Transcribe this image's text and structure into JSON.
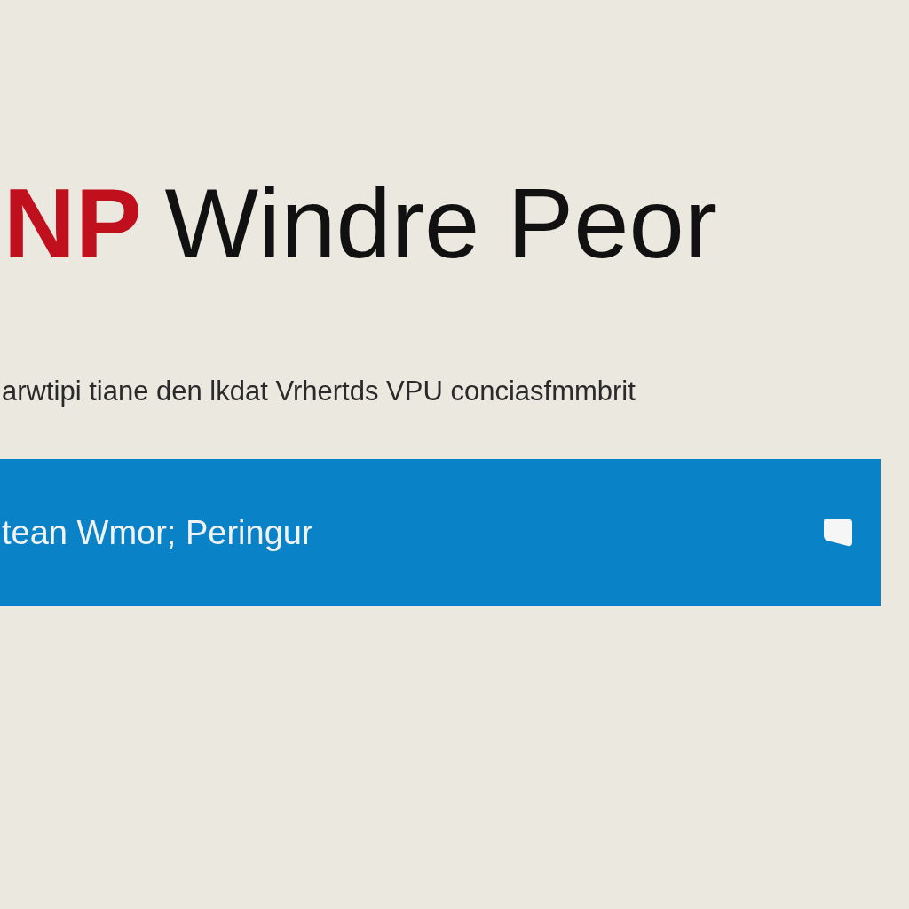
{
  "heading": {
    "accent": "NP",
    "title": "Windre Peor"
  },
  "subtitle": "arwtipi tiane den lkdat Vrhertds VPU conciasfmmbrit",
  "banner": {
    "label": "tean Wmor; Peringur"
  }
}
